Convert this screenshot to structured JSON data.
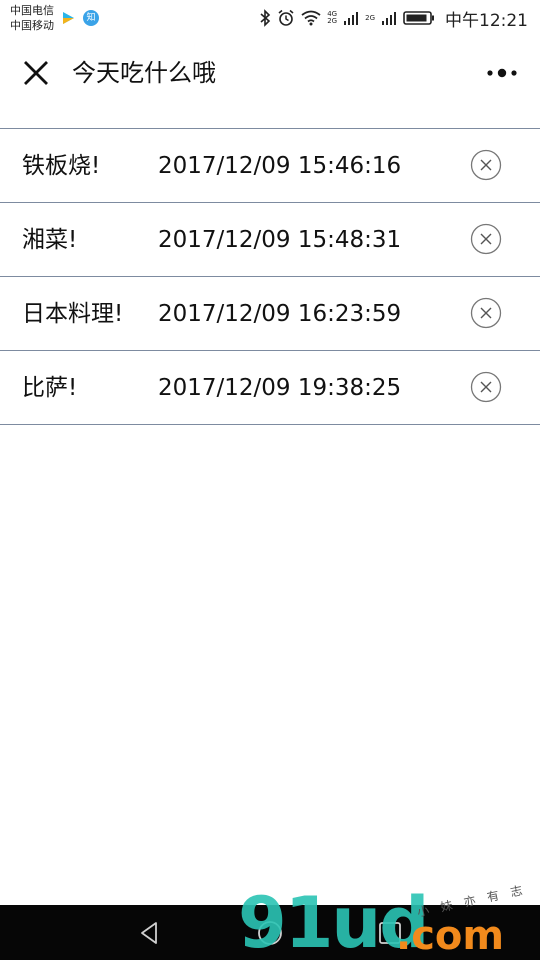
{
  "status_bar": {
    "carrier_1": "中国电信",
    "carrier_2": "中国移动",
    "app_badge_text": "知",
    "net_label_1": "4G",
    "net_label_2": "2G",
    "net_label_3": "2G",
    "time": "中午12:21",
    "icons": [
      "play-app-icon",
      "zhihu-app-icon",
      "bluetooth-icon",
      "alarm-icon",
      "wifi-icon",
      "signal-icon",
      "signal-icon",
      "battery-icon"
    ]
  },
  "nav": {
    "title": "今天吃什么哦",
    "close_icon": "close-icon",
    "more_icon": "more-dots-icon"
  },
  "records": [
    {
      "name": "铁板烧!",
      "time": "2017/12/09 15:46:16"
    },
    {
      "name": "湘菜!",
      "time": "2017/12/09 15:48:31"
    },
    {
      "name": "日本料理!",
      "time": "2017/12/09 16:23:59"
    },
    {
      "name": "比萨!",
      "time": "2017/12/09 19:38:25"
    }
  ],
  "system_nav": {
    "back_icon": "back-triangle-icon",
    "home_icon": "home-circle-icon",
    "recent_icon": "recent-square-icon"
  },
  "watermark": {
    "main": "91ud",
    "suffix": ".com",
    "small": "小 妹 亦 有 志"
  },
  "colors": {
    "divider": "#7d8ba0",
    "system_nav_bg": "#060606",
    "watermark_teal": "#2bc4b4",
    "watermark_orange": "#f28a1c"
  }
}
